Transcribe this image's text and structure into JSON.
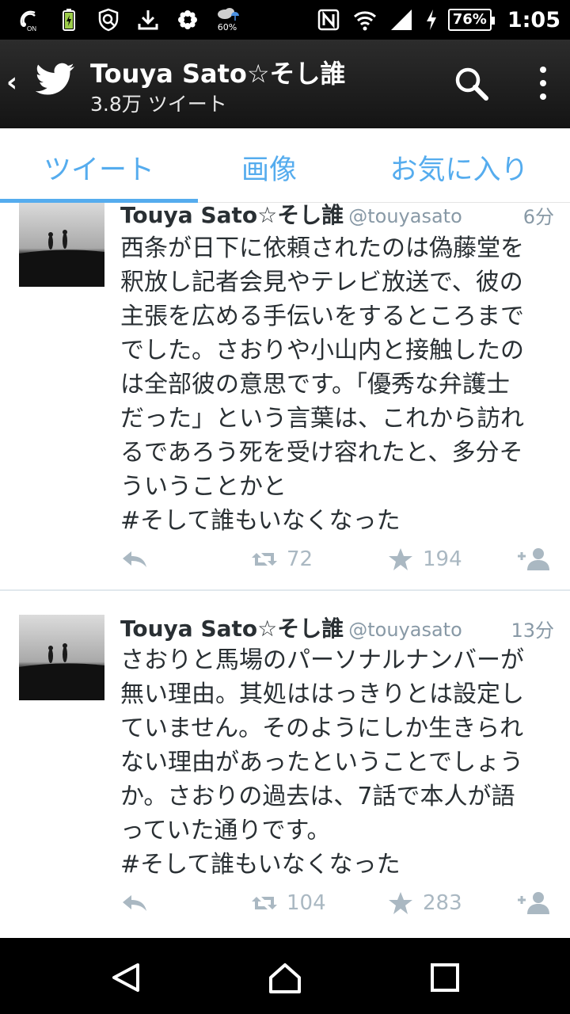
{
  "status_bar": {
    "nfc_label": "ON",
    "weather_percent": "60%",
    "battery": "76%",
    "time": "1:05"
  },
  "header": {
    "back": "‹",
    "title": "Touya Sato☆そし誰",
    "subtitle": "3.8万 ツイート"
  },
  "tabs": [
    {
      "label": "ツイート",
      "active": true
    },
    {
      "label": "画像",
      "active": false
    },
    {
      "label": "お気に入り",
      "active": false
    }
  ],
  "tweets": [
    {
      "name": "Touya Sato☆そし誰",
      "handle": "@touyasato",
      "time": "6分",
      "text": "西条が日下に依頼されたのは偽藤堂を\n釈放し記者会見やテレビ放送で、彼の\n主張を広める手伝いをするところまで\nでした。さおりや小山内と接触したの\nは全部彼の意思です。「優秀な弁護士\nだった」という言葉は、これから訪れ\nるであろう死を受け容れたと、多分そ\nういうことかと\n#そして誰もいなくなった",
      "retweets": "72",
      "favorites": "194"
    },
    {
      "name": "Touya Sato☆そし誰",
      "handle": "@touyasato",
      "time": "13分",
      "text": "さおりと馬場のパーソナルナンバーが\n無い理由。其処ははっきりとは設定し\nていません。そのようにしか生きられ\nない理由があったということでしょう\nか。さおりの過去は、7話で本人が語\nっていた通りです。\n#そして誰もいなくなった",
      "retweets": "104",
      "favorites": "283"
    }
  ],
  "colors": {
    "accent": "#55acee",
    "action_gray": "#aab8c2",
    "text": "#292f33",
    "secondary_text": "#8899a6"
  },
  "icons": [
    "nfc-icon",
    "battery-charging-icon",
    "shield-icon",
    "download-icon",
    "flower-icon",
    "weather-icon",
    "n-mark-icon",
    "wifi-icon",
    "signal-icon",
    "charging-bolt-icon",
    "twitter-bird-icon",
    "search-icon",
    "overflow-menu-icon",
    "reply-icon",
    "retweet-icon",
    "star-icon",
    "follow-icon",
    "nav-back-icon",
    "nav-home-icon",
    "nav-recents-icon"
  ]
}
